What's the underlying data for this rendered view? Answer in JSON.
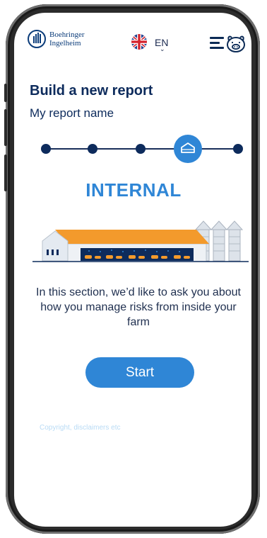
{
  "header": {
    "logo_line1": "Boehringer",
    "logo_line2": "Ingelheim",
    "language": "EN",
    "language_chevron": "⌄"
  },
  "page": {
    "title": "Build a new report",
    "report_name": "My report name"
  },
  "stepper": {
    "total_steps": 5,
    "current_step": 4
  },
  "section": {
    "title": "INTERNAL",
    "description": "In this section, we’d like to ask you about how you manage risks from inside your farm",
    "start_label": "Start"
  },
  "footer": {
    "copyright": "Copyright, disclaimers etc"
  },
  "colors": {
    "accent": "#2f86d6",
    "navy": "#0d2b5c",
    "roof": "#f39a2c"
  }
}
